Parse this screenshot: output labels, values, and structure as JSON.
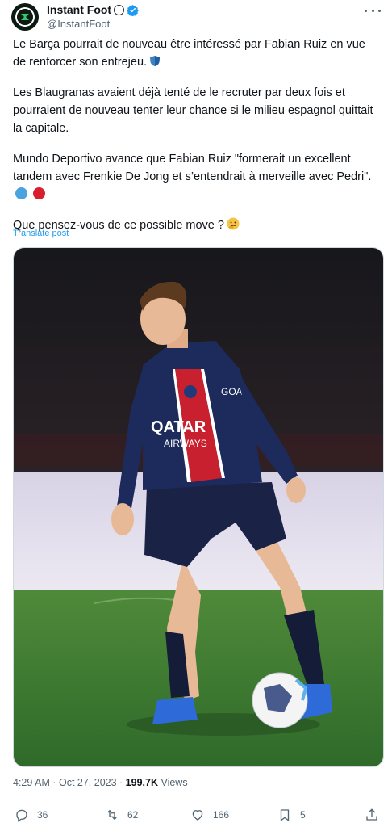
{
  "author": {
    "display_name": "Instant Foot",
    "handle": "@InstantFoot",
    "verified": true,
    "avatar_icon": "instant-foot-logo",
    "name_emoji": "soccer-ball"
  },
  "tweet": {
    "paragraphs": [
      "Le Barça pourrait de nouveau être intéressé par Fabian Ruiz en vue de renforcer son entrejeu.",
      "Les Blaugranas avaient déjà tenté de le recruter par deux fois et pourraient de nouveau tenter leur chance si le milieu espagnol quittait la capitale.",
      "Mundo Deportivo avance que Fabian Ruiz \"formerait un excellent tandem avec Frenkie De Jong et s’entendrait à merveille avec Pedri\".",
      "Que pensez-vous de ce possible move ?"
    ],
    "translate_label": "Translate post"
  },
  "meta": {
    "time": "4:29 AM",
    "separator": " · ",
    "date": "Oct 27, 2023",
    "views_count": "199.7K",
    "views_label": "Views"
  },
  "actions": {
    "replies": "36",
    "reposts": "62",
    "likes": "166",
    "bookmarks": "5"
  },
  "colors": {
    "accent": "#1d9bf0",
    "muted": "#536471",
    "barca_blue": "#4aa3df",
    "barca_red": "#d91e2e"
  }
}
